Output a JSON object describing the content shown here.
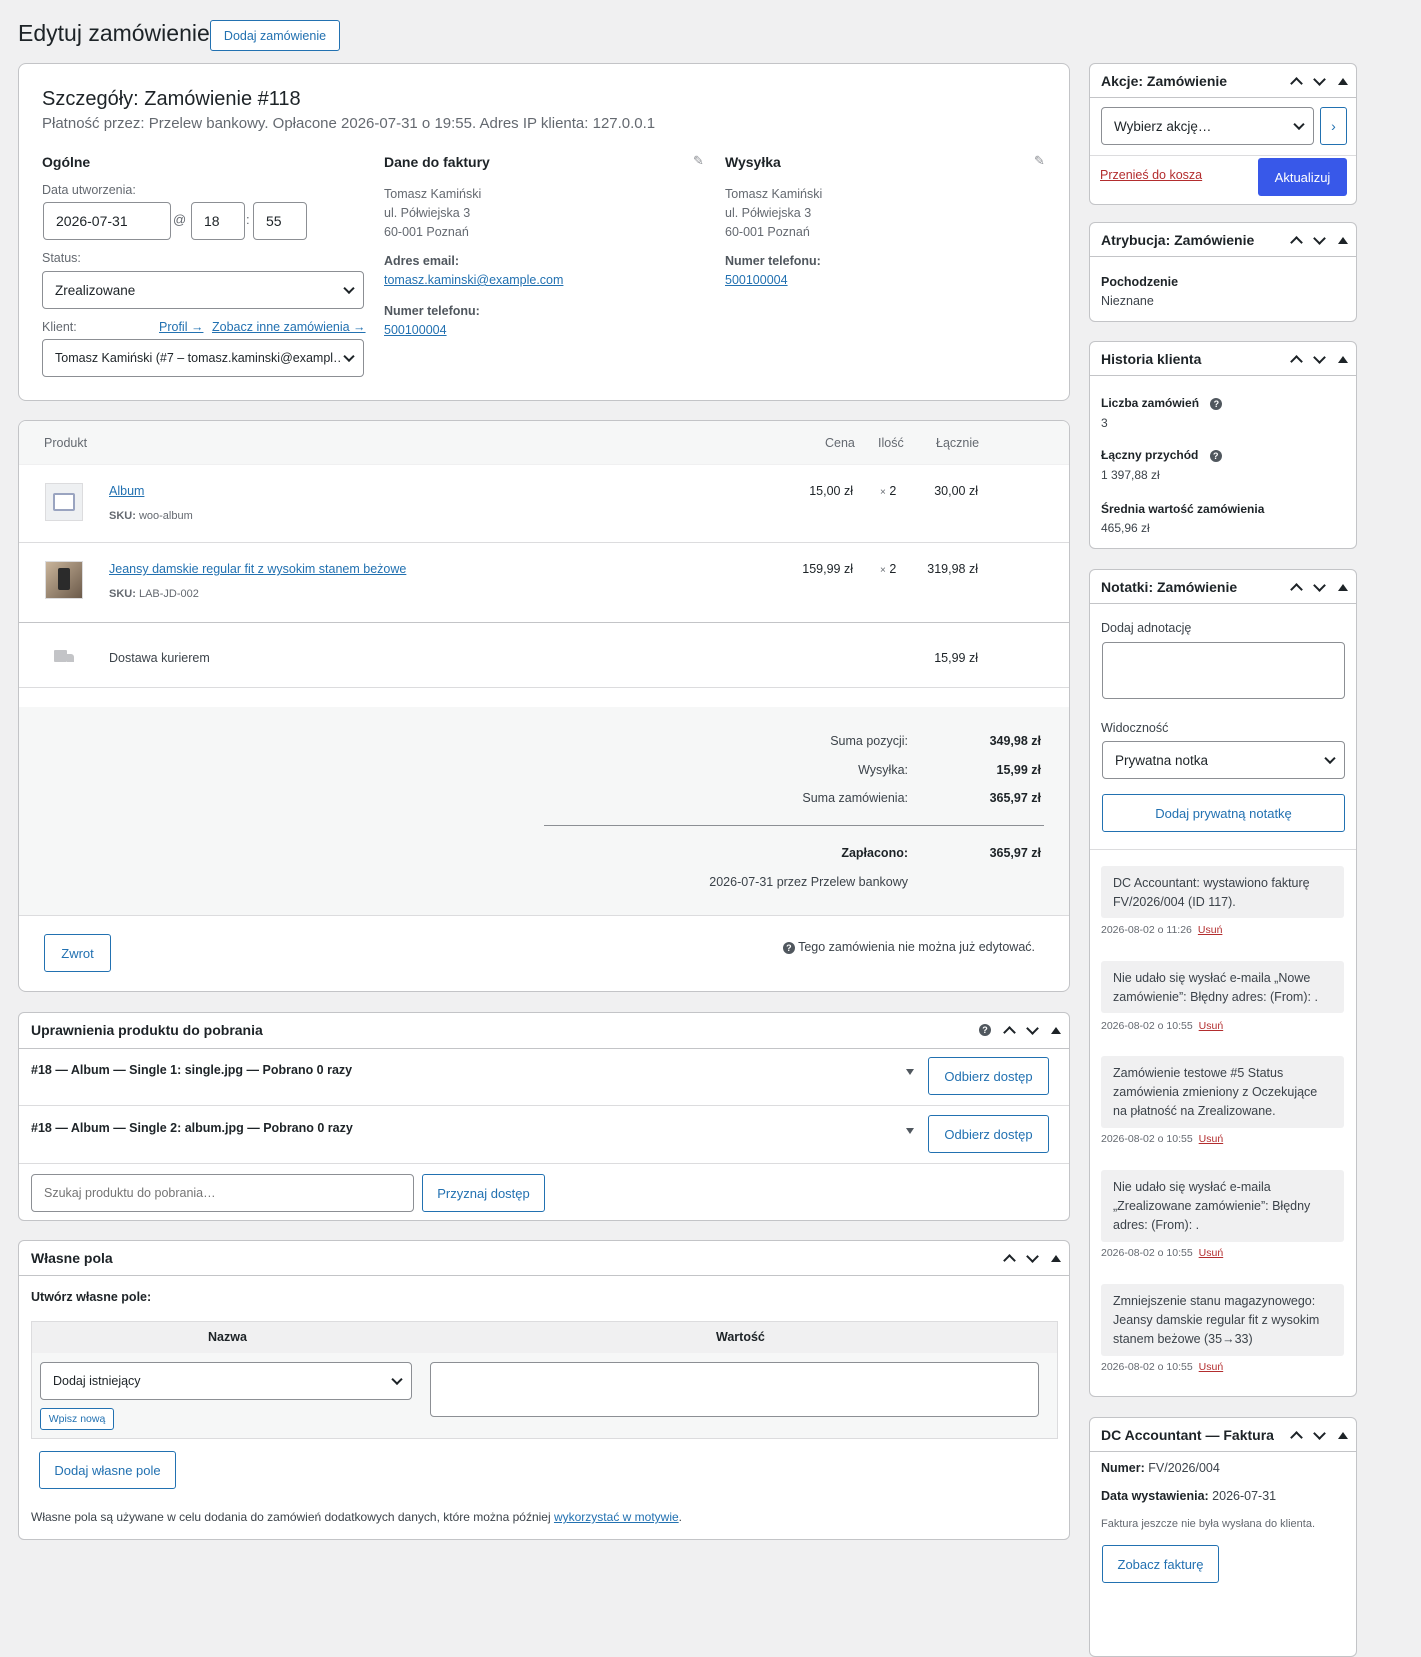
{
  "page": {
    "title": "Edytuj zamówienie",
    "add_order_label": "Dodaj zamówienie"
  },
  "order": {
    "heading": "Szczegóły: Zamówienie #118",
    "subheading": "Płatność przez: Przelew bankowy. Opłacone 2026-07-31 o 19:55. Adres IP klienta: 127.0.0.1",
    "general": {
      "title": "Ogólne",
      "date_label": "Data utworzenia:",
      "date": "2026-07-31",
      "at": "@",
      "hour": "18",
      "colon": ":",
      "minute": "55",
      "status_label": "Status:",
      "status": "Zrealizowane",
      "customer_label": "Klient:",
      "profile_link": "Profil →",
      "other_orders_link": "Zobacz inne zamówienia →",
      "customer": "Tomasz Kamiński (#7 – tomasz.kaminski@exampl…"
    },
    "billing": {
      "title": "Dane do faktury",
      "name": "Tomasz Kamiński",
      "street": "ul. Półwiejska 3",
      "city": "60-001 Poznań",
      "email_label": "Adres email:",
      "email": "tomasz.kaminski@example.com",
      "phone_label": "Numer telefonu:",
      "phone": "500100004"
    },
    "shipping": {
      "title": "Wysyłka",
      "name": "Tomasz Kamiński",
      "street": "ul. Półwiejska 3",
      "city": "60-001 Poznań",
      "phone_label": "Numer telefonu:",
      "phone": "500100004"
    }
  },
  "items": {
    "headers": {
      "product": "Produkt",
      "price": "Cena",
      "qty": "Ilość",
      "total": "Łącznie"
    },
    "rows": [
      {
        "name": "Album",
        "sku_label": "SKU:",
        "sku": "woo-album",
        "price": "15,00 zł",
        "qty_x": "×",
        "qty": "2",
        "total": "30,00 zł"
      },
      {
        "name": "Jeansy damskie regular fit z wysokim stanem beżowe",
        "sku_label": "SKU:",
        "sku": "LAB-JD-002",
        "price": "159,99 zł",
        "qty_x": "×",
        "qty": "2",
        "total": "319,98 zł"
      }
    ],
    "shipping": {
      "name": "Dostawa kurierem",
      "total": "15,99 zł"
    },
    "totals": {
      "subtotal_label": "Suma pozycji:",
      "subtotal": "349,98 zł",
      "shipping_label": "Wysyłka:",
      "shipping": "15,99 zł",
      "order_total_label": "Suma zamówienia:",
      "order_total": "365,97 zł",
      "paid_label": "Zapłacono:",
      "paid": "365,97 zł",
      "paid_note": "2026-07-31 przez Przelew bankowy"
    },
    "refund_label": "Zwrot",
    "not_editable": "Tego zamówienia nie można już edytować."
  },
  "downloads": {
    "title": "Uprawnienia produktu do pobrania",
    "rows": [
      {
        "label": "#18 — Album — Single 1: single.jpg — Pobrano 0 razy",
        "revoke": "Odbierz dostęp"
      },
      {
        "label": "#18 — Album — Single 2: album.jpg — Pobrano 0 razy",
        "revoke": "Odbierz dostęp"
      }
    ],
    "search_placeholder": "Szukaj produktu do pobrania…",
    "grant_label": "Przyznaj dostęp"
  },
  "custom_fields": {
    "title": "Własne pola",
    "create_label": "Utwórz własne pole:",
    "col_name": "Nazwa",
    "col_value": "Wartość",
    "select_existing": "Dodaj istniejący",
    "enter_new": "Wpisz nową",
    "add_button": "Dodaj własne pole",
    "footer_text": "Własne pola są używane w celu dodania do zamówień dodatkowych danych, które można później ",
    "footer_link": "wykorzystać w motywie",
    "footer_end": "."
  },
  "sidebar": {
    "actions": {
      "title": "Akcje: Zamówienie",
      "select": "Wybierz akcję…",
      "trash": "Przenieś do kosza",
      "update": "Aktualizuj"
    },
    "attribution": {
      "title": "Atrybucja: Zamówienie",
      "origin_label": "Pochodzenie",
      "origin": "Nieznane"
    },
    "history": {
      "title": "Historia klienta",
      "orders_label": "Liczba zamówień",
      "orders": "3",
      "revenue_label": "Łączny przychód",
      "revenue": "1 397,88 zł",
      "avg_label": "Średnia wartość zamówienia",
      "avg": "465,96 zł"
    },
    "notes": {
      "title": "Notatki: Zamówienie",
      "add_label": "Dodaj adnotację",
      "visibility_label": "Widoczność",
      "visibility": "Prywatna notka",
      "add_button": "Dodaj prywatną notatkę",
      "delete_label": "Usuń",
      "list": [
        {
          "text": "DC Accountant: wystawiono fakturę FV/2026/004 (ID 117).",
          "meta": "2026-08-02 o 11:26"
        },
        {
          "text": "Nie udało się wysłać e-maila „Nowe zamówienie”: Błędny adres: (From): .",
          "meta": "2026-08-02 o 10:55"
        },
        {
          "text": "Zamówienie testowe #5 Status zamówienia zmieniony z Oczekujące na płatność na Zrealizowane.",
          "meta": "2026-08-02 o 10:55"
        },
        {
          "text": "Nie udało się wysłać e-maila „Zrealizowane zamówienie”: Błędny adres: (From): .",
          "meta": "2026-08-02 o 10:55"
        },
        {
          "text": "Zmniejszenie stanu magazynowego: Jeansy damskie regular fit z wysokim stanem beżowe (35→33)",
          "meta": "2026-08-02 o 10:55"
        }
      ]
    },
    "invoice": {
      "title": "DC Accountant — Faktura",
      "number_label": "Numer:",
      "number": "FV/2026/004",
      "date_label": "Data wystawienia:",
      "date": "2026-07-31",
      "not_sent": "Faktura jeszcze nie była wysłana do klienta.",
      "view_button": "Zobacz fakturę"
    }
  }
}
